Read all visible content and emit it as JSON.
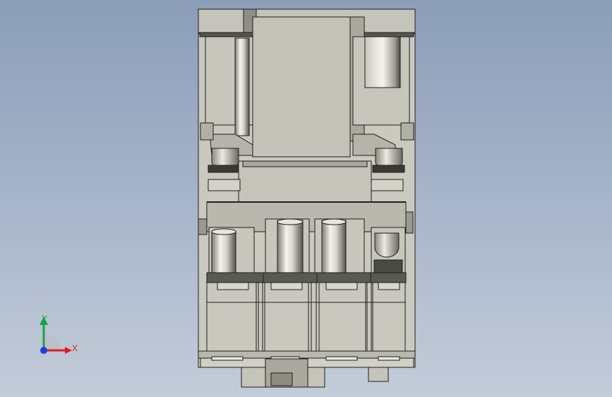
{
  "viewport": {
    "background_top": "#8c9db8",
    "background_bottom": "#c3ccd9"
  },
  "model": {
    "body_color": "#c9c9bf",
    "shade_color": "#a8a89e",
    "edge_color": "#1e1e1e",
    "dark_color": "#4a4a44"
  },
  "triad": {
    "x_label": "X",
    "y_label": "Y",
    "z_label": "Z",
    "x_color": "#e11d1d",
    "y_color": "#16a34a",
    "z_color": "#1d3fe1"
  }
}
